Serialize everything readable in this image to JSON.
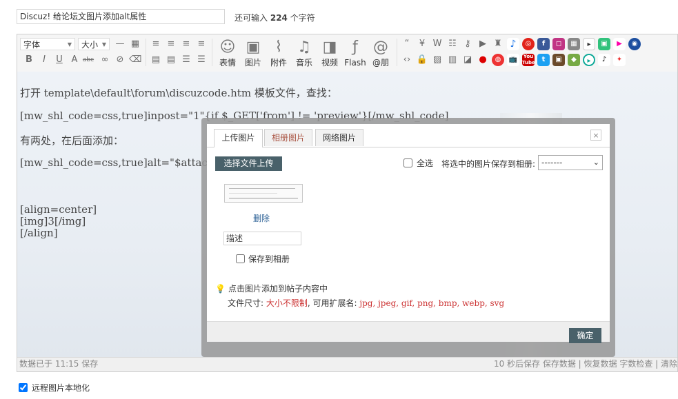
{
  "title_field": {
    "value": "Discuz! 给论坛文图片添加alt属性"
  },
  "char_hint": {
    "prefix": "还可输入",
    "count": "224",
    "suffix": "个字符"
  },
  "toolbar": {
    "font_select": "字体",
    "size_select": "大小",
    "format_icons": [
      "bold",
      "italic",
      "underline",
      "font-color",
      "strikethrough",
      "link",
      "unlink",
      "eraser"
    ],
    "media_buttons": [
      {
        "icon": "emoticon-icon",
        "glyph": "☺",
        "label": "表情"
      },
      {
        "icon": "image-icon",
        "glyph": "▣",
        "label": "图片"
      },
      {
        "icon": "attachment-icon",
        "glyph": "⌇",
        "label": "附件"
      },
      {
        "icon": "music-icon",
        "glyph": "♫",
        "label": "音乐"
      },
      {
        "icon": "video-icon",
        "glyph": "◨",
        "label": "视频"
      },
      {
        "icon": "flash-icon",
        "glyph": "ƒ",
        "label": "Flash"
      },
      {
        "icon": "mention-icon",
        "glyph": "@",
        "label": "@朋"
      }
    ]
  },
  "content": {
    "lines": [
      "打开 template\\default\\forum\\discuzcode.htm 模板文件，查找：",
      "[mw_shl_code=css,true]inpost=\"1\"{if $_GET['from'] != 'preview'}[/mw_shl_code]",
      "有两处，在后面添加：",
      "[mw_shl_code=css,true]alt=\"$attach[",
      "[align=center]",
      "[img]3[/img]",
      "[/align]"
    ]
  },
  "statusbar": {
    "left": "数据已于 11:15 保存",
    "right": "10 秒后保存 保存数据 | 恢复数据   字数检查 | 清除"
  },
  "remote_checkbox": {
    "label": "远程图片本地化",
    "checked": true
  },
  "dialog": {
    "tabs": [
      "上传图片",
      "相册图片",
      "网络图片"
    ],
    "close": "×",
    "upload_button": "选择文件上传",
    "select_all": "全选",
    "save_to_album_label": "将选中的图片保存到相册:",
    "album_option": "-------",
    "delete_link": "删除",
    "description_value": "描述",
    "save_album_checkbox": "保存到相册",
    "tip": "点击图片添加到帖子内容中",
    "filesize_label": "文件尺寸: ",
    "filesize_value": "大小不限制",
    "ext_label": ", 可用扩展名: ",
    "ext_value": "jpg, jpeg, gif, png, bmp, webp, svg",
    "ok_button": "确定"
  },
  "colors": {
    "button_bg": "#49616a",
    "accent_red": "#cc3333",
    "link_blue": "#336699"
  }
}
